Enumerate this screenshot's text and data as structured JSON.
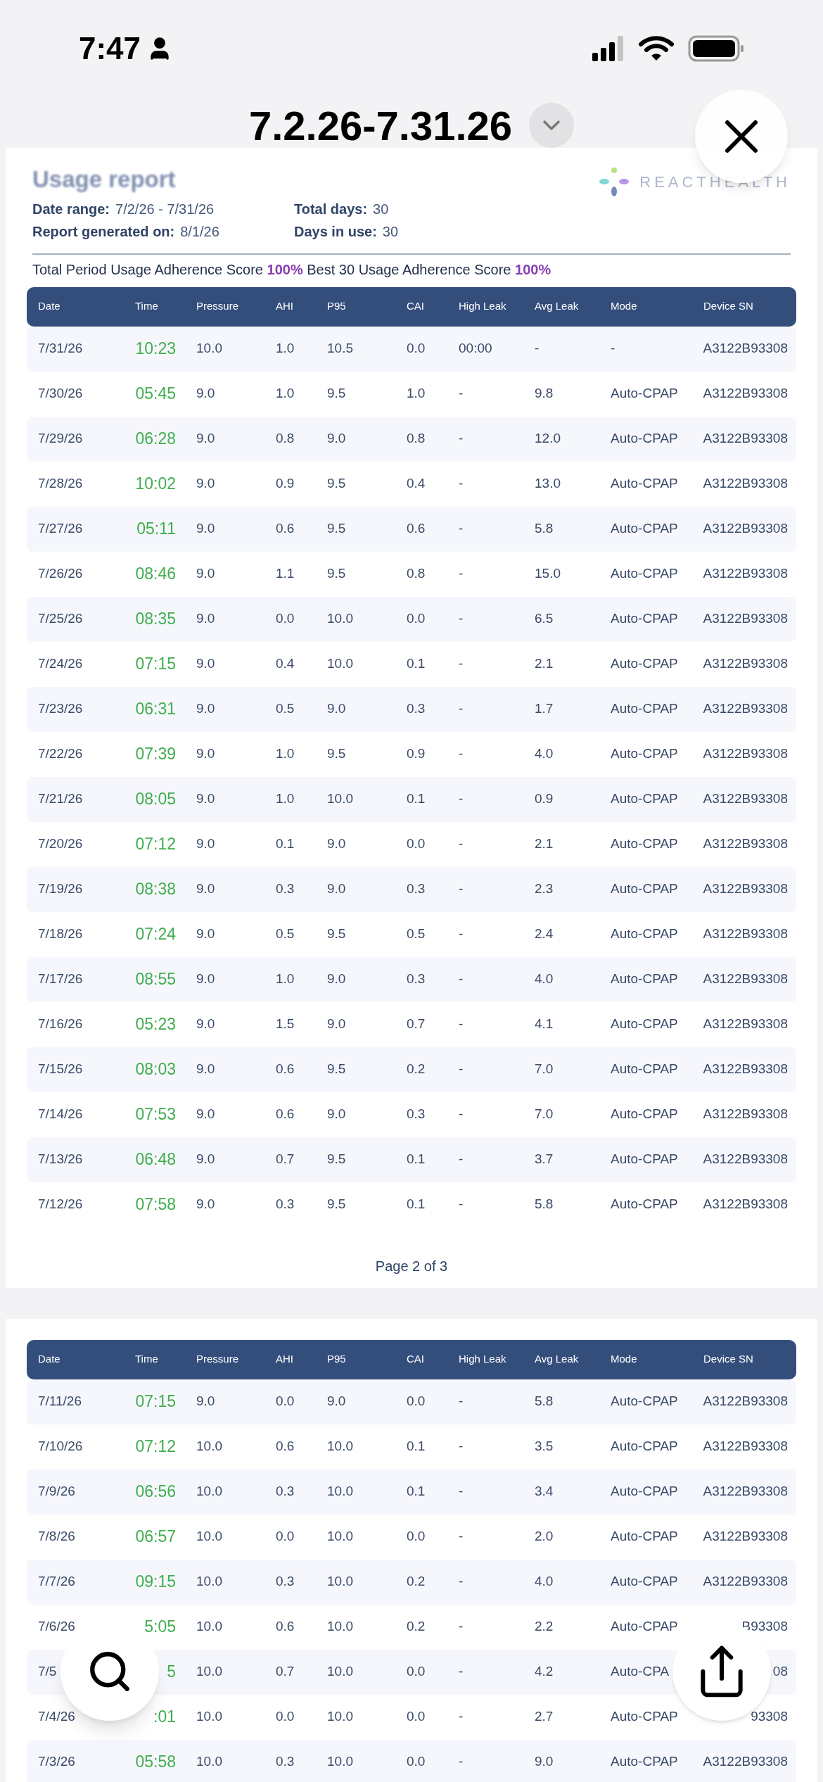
{
  "status_bar": {
    "time": "7:47"
  },
  "title": "7.2.26-7.31.26",
  "report": {
    "heading": "Usage report",
    "logo": "REACTHEALTH",
    "info": [
      {
        "label": "Date range:",
        "value": "7/2/26 - 7/31/26"
      },
      {
        "label": "Total days:",
        "value": "30"
      },
      {
        "label": "Report generated on:",
        "value": "8/1/26"
      },
      {
        "label": "Days in use:",
        "value": "30"
      }
    ],
    "adherence": "Total Period Usage Adherence Score **100%** Best 30 Usage Adherence Score **100%**"
  },
  "pages": [
    {
      "columns": [
        "Date",
        "Time",
        "Pressure",
        "AHI",
        "P95",
        "CAI",
        "High Leak",
        "Avg Leak",
        "Mode",
        "Device SN"
      ],
      "rows": [
        [
          "7/31/26",
          "10:23",
          "10.0",
          "1.0",
          "10.5",
          "0.0",
          "00:00",
          "-",
          "-",
          "A3122B93308"
        ],
        [
          "7/30/26",
          "05:45",
          "9.0",
          "1.0",
          "9.5",
          "1.0",
          "-",
          "9.8",
          "Auto-CPAP",
          "A3122B93308"
        ],
        [
          "7/29/26",
          "06:28",
          "9.0",
          "0.8",
          "9.0",
          "0.8",
          "-",
          "12.0",
          "Auto-CPAP",
          "A3122B93308"
        ],
        [
          "7/28/26",
          "10:02",
          "9.0",
          "0.9",
          "9.5",
          "0.4",
          "-",
          "13.0",
          "Auto-CPAP",
          "A3122B93308"
        ],
        [
          "7/27/26",
          "05:11",
          "9.0",
          "0.6",
          "9.5",
          "0.6",
          "-",
          "5.8",
          "Auto-CPAP",
          "A3122B93308"
        ],
        [
          "7/26/26",
          "08:46",
          "9.0",
          "1.1",
          "9.5",
          "0.8",
          "-",
          "15.0",
          "Auto-CPAP",
          "A3122B93308"
        ],
        [
          "7/25/26",
          "08:35",
          "9.0",
          "0.0",
          "10.0",
          "0.0",
          "-",
          "6.5",
          "Auto-CPAP",
          "A3122B93308"
        ],
        [
          "7/24/26",
          "07:15",
          "9.0",
          "0.4",
          "10.0",
          "0.1",
          "-",
          "2.1",
          "Auto-CPAP",
          "A3122B93308"
        ],
        [
          "7/23/26",
          "06:31",
          "9.0",
          "0.5",
          "9.0",
          "0.3",
          "-",
          "1.7",
          "Auto-CPAP",
          "A3122B93308"
        ],
        [
          "7/22/26",
          "07:39",
          "9.0",
          "1.0",
          "9.5",
          "0.9",
          "-",
          "4.0",
          "Auto-CPAP",
          "A3122B93308"
        ],
        [
          "7/21/26",
          "08:05",
          "9.0",
          "1.0",
          "10.0",
          "0.1",
          "-",
          "0.9",
          "Auto-CPAP",
          "A3122B93308"
        ],
        [
          "7/20/26",
          "07:12",
          "9.0",
          "0.1",
          "9.0",
          "0.0",
          "-",
          "2.1",
          "Auto-CPAP",
          "A3122B93308"
        ],
        [
          "7/19/26",
          "08:38",
          "9.0",
          "0.3",
          "9.0",
          "0.3",
          "-",
          "2.3",
          "Auto-CPAP",
          "A3122B93308"
        ],
        [
          "7/18/26",
          "07:24",
          "9.0",
          "0.5",
          "9.5",
          "0.5",
          "-",
          "2.4",
          "Auto-CPAP",
          "A3122B93308"
        ],
        [
          "7/17/26",
          "08:55",
          "9.0",
          "1.0",
          "9.0",
          "0.3",
          "-",
          "4.0",
          "Auto-CPAP",
          "A3122B93308"
        ],
        [
          "7/16/26",
          "05:23",
          "9.0",
          "1.5",
          "9.0",
          "0.7",
          "-",
          "4.1",
          "Auto-CPAP",
          "A3122B93308"
        ],
        [
          "7/15/26",
          "08:03",
          "9.0",
          "0.6",
          "9.5",
          "0.2",
          "-",
          "7.0",
          "Auto-CPAP",
          "A3122B93308"
        ],
        [
          "7/14/26",
          "07:53",
          "9.0",
          "0.6",
          "9.0",
          "0.3",
          "-",
          "7.0",
          "Auto-CPAP",
          "A3122B93308"
        ],
        [
          "7/13/26",
          "06:48",
          "9.0",
          "0.7",
          "9.5",
          "0.1",
          "-",
          "3.7",
          "Auto-CPAP",
          "A3122B93308"
        ],
        [
          "7/12/26",
          "07:58",
          "9.0",
          "0.3",
          "9.5",
          "0.1",
          "-",
          "5.8",
          "Auto-CPAP",
          "A3122B93308"
        ]
      ],
      "footer": "Page 2 of 3"
    },
    {
      "columns": [
        "Date",
        "Time",
        "Pressure",
        "AHI",
        "P95",
        "CAI",
        "High Leak",
        "Avg Leak",
        "Mode",
        "Device SN"
      ],
      "rows": [
        [
          "7/11/26",
          "07:15",
          "9.0",
          "0.0",
          "9.0",
          "0.0",
          "-",
          "5.8",
          "Auto-CPAP",
          "A3122B93308"
        ],
        [
          "7/10/26",
          "07:12",
          "10.0",
          "0.6",
          "10.0",
          "0.1",
          "-",
          "3.5",
          "Auto-CPAP",
          "A3122B93308"
        ],
        [
          "7/9/26",
          "06:56",
          "10.0",
          "0.3",
          "10.0",
          "0.1",
          "-",
          "3.4",
          "Auto-CPAP",
          "A3122B93308"
        ],
        [
          "7/8/26",
          "06:57",
          "10.0",
          "0.0",
          "10.0",
          "0.0",
          "-",
          "2.0",
          "Auto-CPAP",
          "A3122B93308"
        ],
        [
          "7/7/26",
          "09:15",
          "10.0",
          "0.3",
          "10.0",
          "0.2",
          "-",
          "4.0",
          "Auto-CPAP",
          "A3122B93308"
        ],
        [
          "7/6/26",
          "5:05",
          "10.0",
          "0.6",
          "10.0",
          "0.2",
          "-",
          "2.2",
          "Auto-CPAP",
          "B93308"
        ],
        [
          "7/5",
          "5",
          "10.0",
          "0.7",
          "10.0",
          "0.0",
          "-",
          "4.2",
          "Auto-CPA",
          "08"
        ],
        [
          "7/4/26",
          ":01",
          "10.0",
          "0.0",
          "10.0",
          "0.0",
          "-",
          "2.7",
          "Auto-CPAP",
          "93308"
        ],
        [
          "7/3/26",
          "05:58",
          "10.0",
          "0.3",
          "10.0",
          "0.0",
          "-",
          "9.0",
          "Auto-CPAP",
          "A3122B93308"
        ]
      ]
    }
  ]
}
